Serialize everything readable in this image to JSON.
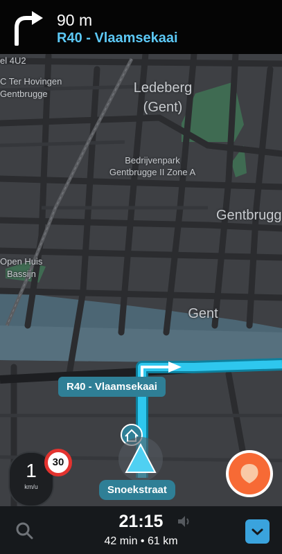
{
  "nav": {
    "distance": "90 m",
    "street": "R40 - Vlaamsekaai"
  },
  "map_labels": [
    {
      "text": "el 4U2"
    },
    {
      "text": "C Ter Hovingen"
    },
    {
      "text": "Gentbrugge"
    },
    {
      "text": "Ledeberg"
    },
    {
      "text": "(Gent)"
    },
    {
      "text": "Bedrijvenpark"
    },
    {
      "text": "Gentbrugge II Zone A"
    },
    {
      "text": "Gentbrugge"
    },
    {
      "text": "Open Huis"
    },
    {
      "text": "Bassijn"
    },
    {
      "text": "Gent"
    }
  ],
  "route_label": "R40 - Vlaamsekaai",
  "current_street": "Snoekstraat",
  "speed": {
    "value": "1",
    "unit": "km/u",
    "limit": "30"
  },
  "eta": {
    "time": "21:15",
    "info": "42 min • 61 km"
  },
  "colors": {
    "route": "#2ec7ee",
    "report": "#f76a35",
    "top_accent": "#5cc8f5",
    "menu": "#3aa3dd"
  }
}
